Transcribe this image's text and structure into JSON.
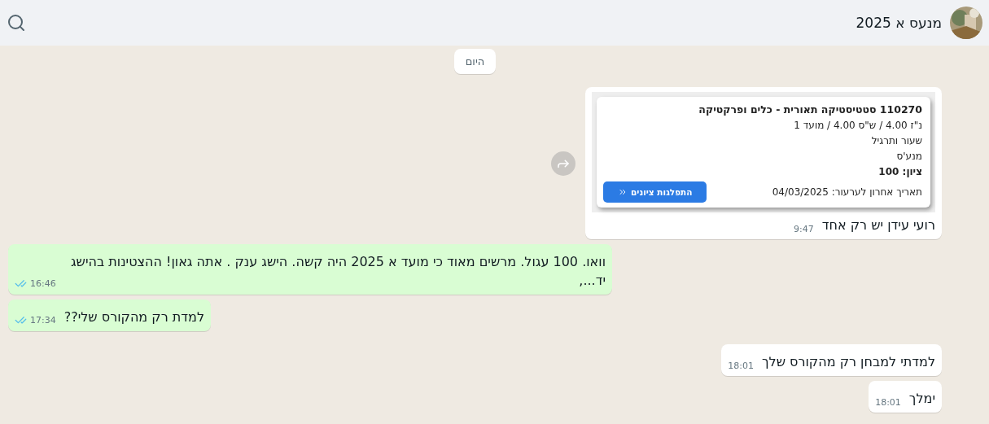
{
  "header": {
    "title": "מנעס א 2025"
  },
  "date_chip": "היום",
  "messages": [
    {
      "incoming": true,
      "forwardable": true,
      "card": {
        "title": "110270 סטטיסטיקה תאורית - כלים ופרקטיקה",
        "lines": [
          "נ\"ז 4.00 / ש\"ס 4.00 / מועד 1",
          "שעור ותרגיל",
          "מנע'ס"
        ],
        "grade": "ציון: 100",
        "deadline": "תאריך אחרון לערעור: 04/03/2025",
        "button": "התפלגות ציונים"
      },
      "text": "רועי עידן יש רק אחד",
      "time": "9:47"
    },
    {
      "kind": "text",
      "incoming": false,
      "text": "וואו. 100 עגול. מרשים מאוד כי מועד א 2025 היה קשה. הישג ענק . אתה גאון! ההצטינות בהישג יד...,",
      "time": "16:46",
      "read": true
    },
    {
      "kind": "text",
      "incoming": false,
      "text": "למדת רק מהקורס שלי??",
      "time": "17:34",
      "read": true
    },
    {
      "kind": "text",
      "incoming": true,
      "text": "למדתי למבחן רק מהקורס שלך",
      "time": "18:01"
    },
    {
      "kind": "text",
      "incoming": true,
      "text": "ימלך",
      "time": "18:01"
    }
  ]
}
